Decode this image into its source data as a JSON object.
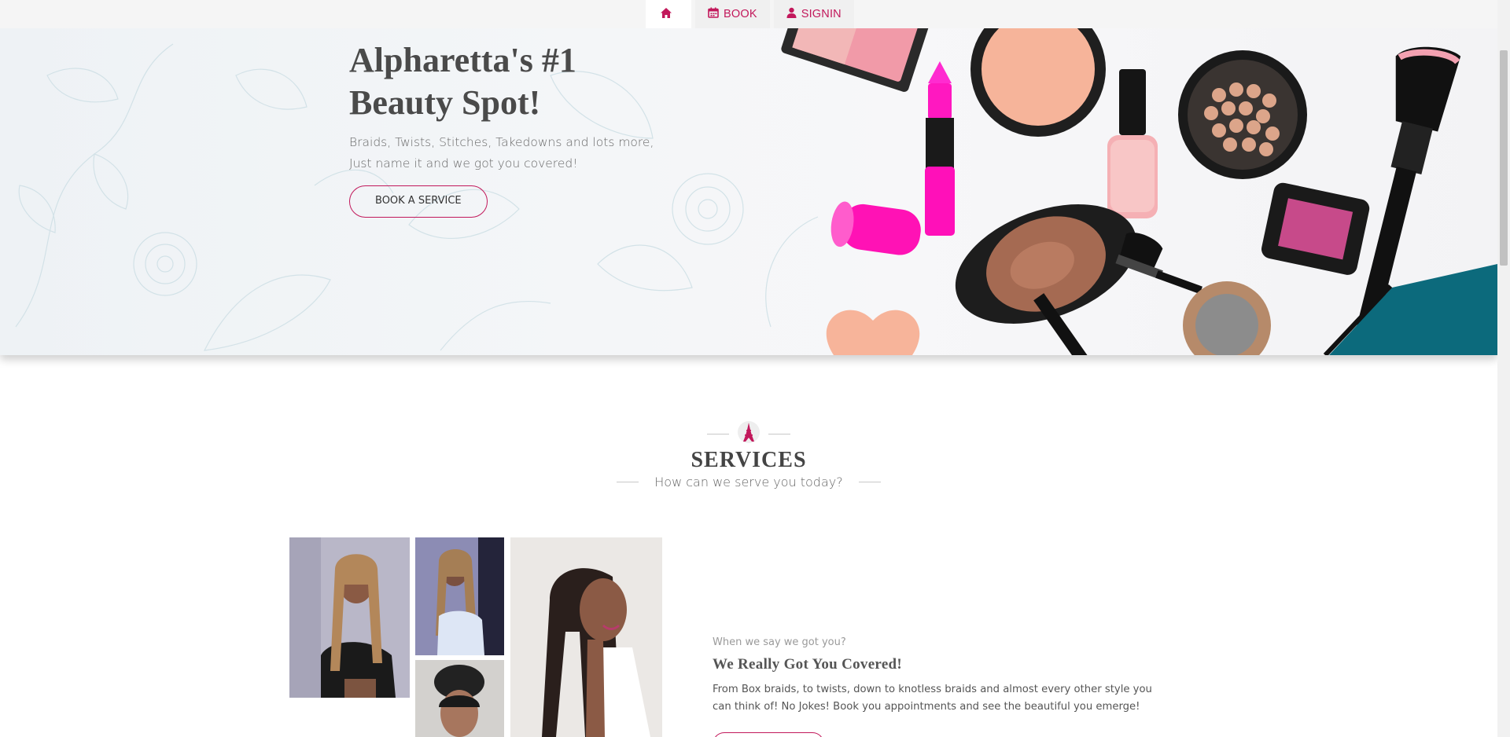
{
  "nav": {
    "home_icon": "home-icon",
    "book_label": "BOOK",
    "book_icon": "calendar-icon",
    "signin_label": "SIGNIN",
    "signin_icon": "user-icon"
  },
  "hero": {
    "title_line1": "Alpharetta's #1",
    "title_line2": "Beauty Spot!",
    "subtitle_line1": "Braids, Twists, Stitches, Takedowns and lots more,",
    "subtitle_line2": "Just name it and we got you covered!",
    "cta_label": "BOOK A SERVICE"
  },
  "services": {
    "emblem_icon": "eiffel-tower-icon",
    "title": "SERVICES",
    "subtitle": "How can we serve you today?"
  },
  "feature": {
    "pre": "When we say we got you?",
    "title": "We Really Got You Covered!",
    "text": "From Box braids, to twists, down to knotless braids and almost every other style you can think of! No Jokes! Book you appointments and see the beautiful you emerge!"
  },
  "colors": {
    "accent": "#c2185b",
    "heading": "#4a4a4a",
    "nav_bg": "#f5f5f5"
  }
}
